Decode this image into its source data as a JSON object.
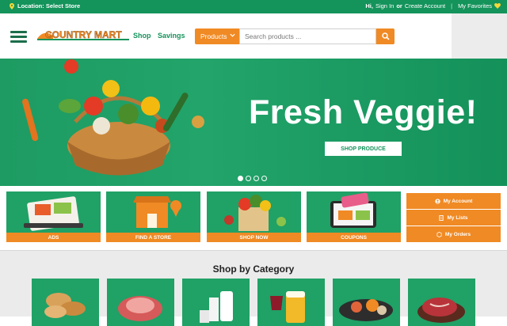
{
  "topbar": {
    "location": "Location: Select Store",
    "greeting": "Hi,",
    "sign_in": "Sign In",
    "or": "or",
    "create_account": "Create Account",
    "favorites": "My Favorites"
  },
  "header": {
    "logo_text": "COUNTRY MART",
    "nav": [
      "Shop",
      "Savings"
    ],
    "search_dropdown": "Products",
    "search_placeholder": "Search products ..."
  },
  "hero": {
    "headline": "Fresh Veggie!",
    "button": "SHOP PRODUCE",
    "slide_count": 4,
    "active_slide": 1
  },
  "tiles": [
    "ADS",
    "FIND A STORE",
    "SHOP NOW",
    "COUPONS"
  ],
  "account_links": [
    "My Account",
    "My Lists",
    "My Orders"
  ],
  "categories_title": "Shop by Category",
  "colors": {
    "brand_green": "#14935b",
    "accent_orange": "#f08a24"
  }
}
